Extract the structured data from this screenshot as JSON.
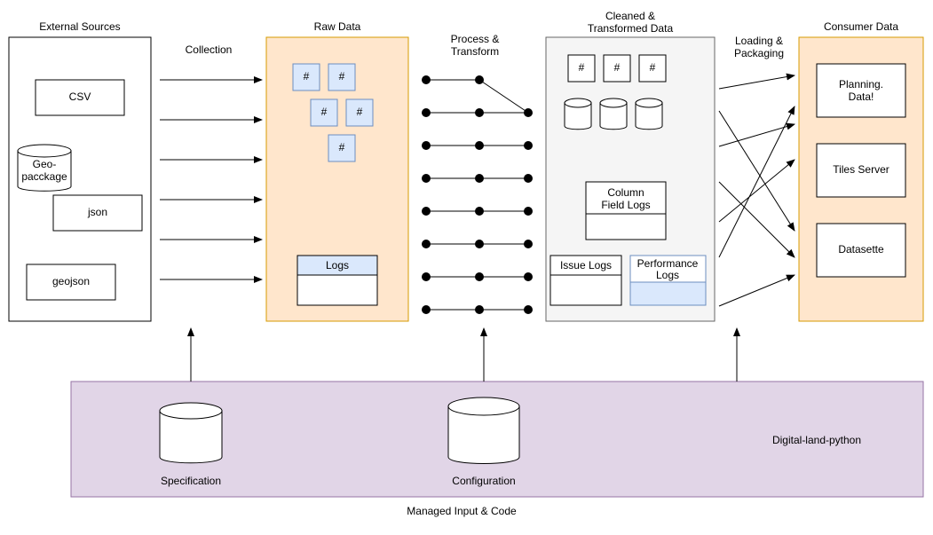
{
  "stages": {
    "external": {
      "title": "External Sources",
      "csv": "CSV",
      "geopackage": "Geo-\npacckage",
      "json": "json",
      "geojson": "geojson"
    },
    "raw": {
      "title": "Raw Data",
      "hash": "#",
      "logs": "Logs"
    },
    "process": {
      "title": "Process &\nTransform"
    },
    "cleaned": {
      "title": "Cleaned &\nTransformed Data",
      "hash": "#",
      "columnFieldLogs": "Column\nField Logs",
      "issueLogs": "Issue Logs",
      "performanceLogs": "Performance\nLogs"
    },
    "consumer": {
      "title": "Consumer Data",
      "planning": "Planning.\nData!",
      "tiles": "Tiles Server",
      "datasette": "Datasette"
    }
  },
  "arrows": {
    "collection": "Collection",
    "loading": "Loading &\nPackaging"
  },
  "managed": {
    "specification": "Specification",
    "configuration": "Configuration",
    "digitalLandPython": "Digital-land-python",
    "title": "Managed Input & Code"
  }
}
